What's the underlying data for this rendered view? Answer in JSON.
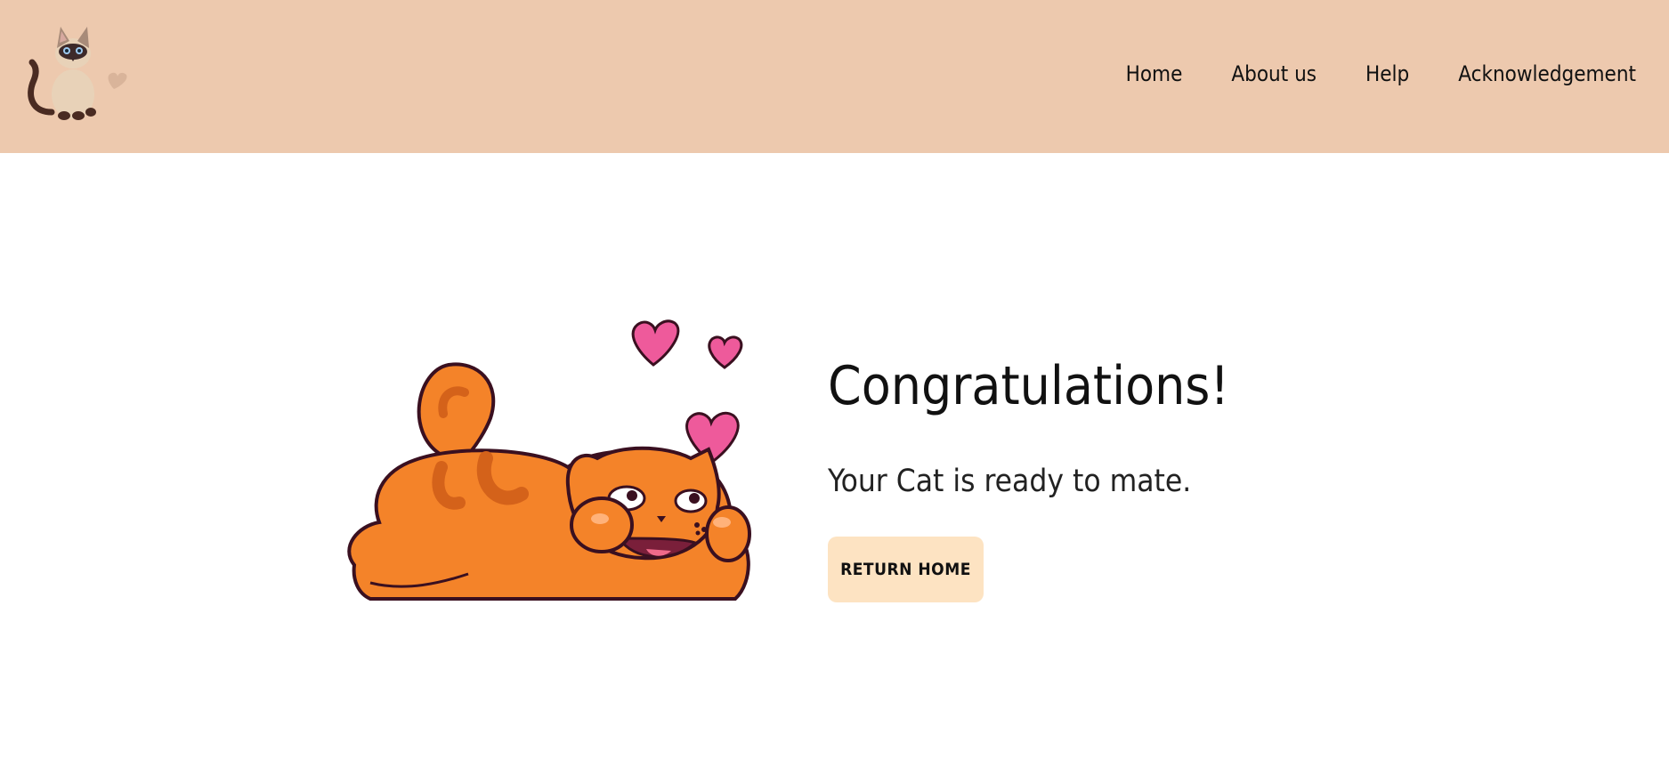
{
  "nav": {
    "items": [
      {
        "label": "Home"
      },
      {
        "label": "About us"
      },
      {
        "label": "Help"
      },
      {
        "label": "Acknowledgement"
      }
    ]
  },
  "main": {
    "title": "Congratulations!",
    "message": "Your Cat is ready to mate.",
    "button_label": "RETURN HOME"
  },
  "colors": {
    "header_bg": "#edc9ae",
    "button_bg": "#fde3c2",
    "cat_orange": "#f48329",
    "heart_pink": "#ee5a9b"
  },
  "icons": {
    "logo": "siamese-cat-logo",
    "illustration": "happy-orange-cat-with-hearts"
  }
}
